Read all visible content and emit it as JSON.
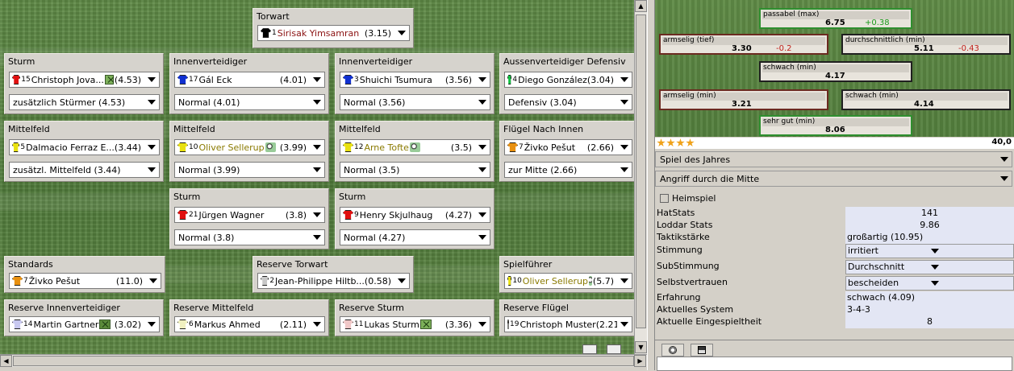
{
  "lineup": {
    "positions": [
      {
        "title": "Torwart",
        "shirt": "#000000",
        "num": "1",
        "name": "Sirisak  Yimsamran",
        "rating": "(3.15)",
        "name_color": "#8a1010",
        "tag": "",
        "order": ""
      },
      {
        "title": "Sturm",
        "shirt": "#e01010",
        "num": "15",
        "name": "Christoph  Jova...",
        "rating": "(4.53)",
        "name_color": "#000000",
        "tag": "field-tag",
        "order": "zusätzlich Stürmer (4.53)"
      },
      {
        "title": "Innenverteidiger",
        "shirt": "#1030d0",
        "num": "17",
        "name": "Gál  Eck",
        "rating": "(4.01)",
        "name_color": "#000000",
        "tag": "",
        "order": "Normal (4.01)"
      },
      {
        "title": "Innenverteidiger",
        "shirt": "#1030d0",
        "num": "3",
        "name": "Shuichi  Tsumura",
        "rating": "(3.56)",
        "name_color": "#000000",
        "tag": "",
        "order": "Normal (3.56)"
      },
      {
        "title": "Aussenverteidiger Defensiv",
        "shirt": "#10c040",
        "num": "4",
        "name": "Diego  González",
        "rating": "(3.04)",
        "name_color": "#000000",
        "tag": "",
        "order": "Defensiv (3.04)"
      },
      {
        "title": "Mittelfeld",
        "shirt": "#e8e010",
        "num": "5",
        "name": "Dalmacio  Ferraz E...",
        "rating": "(3.44)",
        "name_color": "#000000",
        "tag": "",
        "order": "zusätzl. Mittelfeld (3.44)"
      },
      {
        "title": "Mittelfeld",
        "shirt": "#e8e010",
        "num": "10",
        "name": "Oliver  Sellerup",
        "rating": "(3.99)",
        "name_color": "#8a7a00",
        "tag": "ball-tag",
        "order": "Normal (3.99)"
      },
      {
        "title": "Mittelfeld",
        "shirt": "#e8e010",
        "num": "12",
        "name": "Arne  Tofte",
        "rating": "(3.5)",
        "name_color": "#8a7a00",
        "tag": "ball-tag",
        "order": "Normal (3.5)"
      },
      {
        "title": "Flügel Nach Innen",
        "shirt": "#e89010",
        "num": "7",
        "name": "Živko  Pešut",
        "rating": "(2.66)",
        "name_color": "#000000",
        "tag": "",
        "order": "zur Mitte (2.66)"
      },
      {
        "title": "Sturm",
        "shirt": "#e01010",
        "num": "21",
        "name": "Jürgen  Wagner",
        "rating": "(3.8)",
        "name_color": "#000000",
        "tag": "",
        "order": "Normal (3.8)"
      },
      {
        "title": "Sturm",
        "shirt": "#e01010",
        "num": "9",
        "name": "Henry  Skjulhaug",
        "rating": "(4.27)",
        "name_color": "#000000",
        "tag": "",
        "order": "Normal (4.27)"
      },
      {
        "title": "Standards",
        "shirt": "#e89010",
        "num": "7",
        "name": "Živko  Pešut",
        "rating": "(11.0)",
        "name_color": "#000000",
        "tag": "",
        "order": ""
      },
      {
        "title": "Reserve Torwart",
        "shirt": "#c8c8c8",
        "num": "2",
        "name": "Jean-Philippe  Hiltb...",
        "rating": "(0.58)",
        "name_color": "#000000",
        "tag": "",
        "order": ""
      },
      {
        "title": "Spielführer",
        "shirt": "#e8e010",
        "num": "10",
        "name": "Oliver  Sellerup",
        "rating": "(5.7)",
        "name_color": "#8a7a00",
        "tag": "ball-tag",
        "order": ""
      },
      {
        "title": "Reserve Innenverteidiger",
        "shirt": "#c8c8f0",
        "num": "14",
        "name": "Martin  Gartner",
        "rating": "(3.02)",
        "name_color": "#000000",
        "tag": "shirt-tag",
        "order": ""
      },
      {
        "title": "Reserve Mittelfeld",
        "shirt": "#f0f0c0",
        "num": "6",
        "name": "Markus  Ahmed",
        "rating": "(2.11)",
        "name_color": "#000000",
        "tag": "",
        "order": ""
      },
      {
        "title": "Reserve Sturm",
        "shirt": "#f0c8c8",
        "num": "11",
        "name": "Lukas  Sturm",
        "rating": "(3.36)",
        "name_color": "#000000",
        "tag": "field-tag",
        "order": ""
      },
      {
        "title": "Reserve Flügel",
        "shirt": "#f0d8c0",
        "num": "19",
        "name": "Christoph  Muster",
        "rating": "(2.21)",
        "name_color": "#000000",
        "tag": "",
        "order": ""
      }
    ]
  },
  "ratings": [
    {
      "label": "passabel (max)",
      "value": "6.75",
      "delta": "+0.38",
      "sign": "pos",
      "style": "good"
    },
    {
      "label": "armselig (tief)",
      "value": "3.30",
      "delta": "-0.2",
      "sign": "neg",
      "style": "bad"
    },
    {
      "label": "durchschnittlich (min)",
      "value": "5.11",
      "delta": "-0.43",
      "sign": "neg",
      "style": "blk"
    },
    {
      "label": "schwach (min)",
      "value": "4.17",
      "delta": "",
      "sign": "",
      "style": "blk"
    },
    {
      "label": "armselig (min)",
      "value": "3.21",
      "delta": "",
      "sign": "",
      "style": "bad"
    },
    {
      "label": "schwach (min)",
      "value": "4.14",
      "delta": "",
      "sign": "",
      "style": "blk"
    },
    {
      "label": "sehr gut (min)",
      "value": "8.06",
      "delta": "",
      "sign": "",
      "style": "good"
    }
  ],
  "stars_count": 4,
  "total_rating": "40,0",
  "match_type": "Spiel des Jahres",
  "tactic": "Angriff durch die Mitte",
  "home_label": "Heimspiel",
  "stats": {
    "hatstats_label": "HatStats",
    "hatstats": "141",
    "loddar_label": "Loddar Stats",
    "loddar": "9.86",
    "taktik_label": "Taktikstärke",
    "taktik": "großartig (10.95)",
    "stimmung_label": "Stimmung",
    "stimmung": "irritiert",
    "substimmung_label": "SubStimmung",
    "substimmung": "Durchschnitt",
    "selbst_label": "Selbstvertrauen",
    "selbst": "bescheiden",
    "erfahrung_label": "Erfahrung",
    "erfahrung": "schwach (4.09)",
    "system_label": "Aktuelles System",
    "system": "3-4-3",
    "eingespielt_label": "Aktuelle Eingespieltheit",
    "eingespielt": "8"
  }
}
